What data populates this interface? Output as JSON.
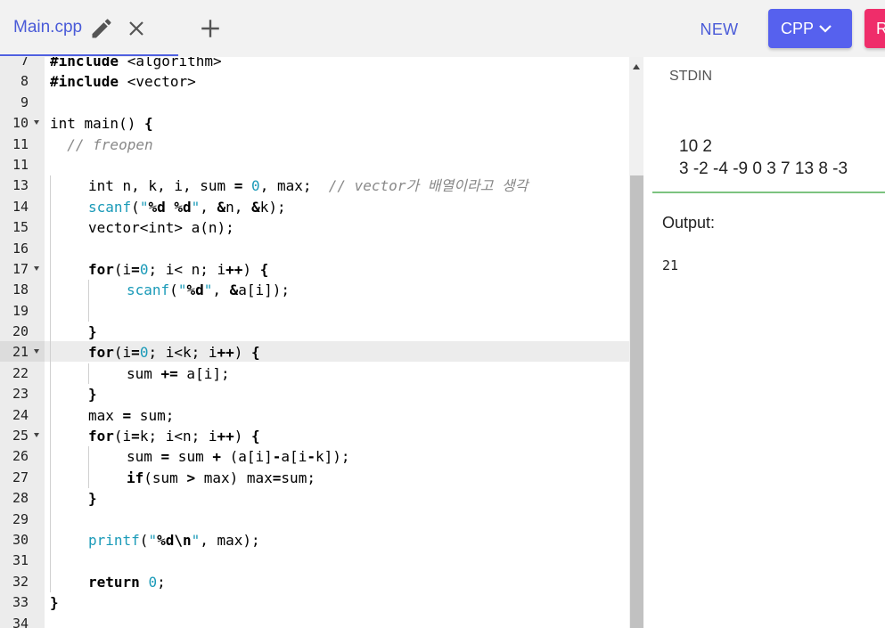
{
  "tab": {
    "filename": "Main.cpp"
  },
  "toolbar": {
    "new_label": "NEW",
    "language": "CPP",
    "run_label": "R"
  },
  "icons": {
    "edit": "pencil-icon",
    "close": "close-icon",
    "add": "plus-icon",
    "dropdown": "chevron-down-icon"
  },
  "colors": {
    "accent": "#5661ee",
    "run": "#ef2d6a",
    "divider": "#7cc37f"
  },
  "editor": {
    "active_line": 21,
    "lines": [
      {
        "n": 7,
        "fold": false,
        "indent": 0,
        "tokens": [
          [
            "#include ",
            "kw"
          ],
          [
            "<algorithm>",
            "txt"
          ]
        ]
      },
      {
        "n": 8,
        "fold": false,
        "indent": 0,
        "tokens": [
          [
            "#include ",
            "kw"
          ],
          [
            "<vector>",
            "txt"
          ]
        ]
      },
      {
        "n": 9,
        "fold": false,
        "indent": 0,
        "tokens": []
      },
      {
        "n": 10,
        "fold": true,
        "indent": 0,
        "tokens": [
          [
            "int main() ",
            "txt"
          ],
          [
            "{",
            "kw"
          ]
        ]
      },
      {
        "n": 11,
        "fold": false,
        "indent": 0,
        "tokens": [
          [
            "  // freopen",
            "cm"
          ]
        ]
      },
      {
        "n": 11,
        "fold": false,
        "indent": 0,
        "tokens": []
      },
      {
        "n": 13,
        "fold": false,
        "indent": 1,
        "tokens": [
          [
            "int n, k, i, sum ",
            "txt"
          ],
          [
            "=",
            "kw"
          ],
          [
            " ",
            "txt"
          ],
          [
            "0",
            "num"
          ],
          [
            ", max;  ",
            "txt"
          ],
          [
            "// vector가 배열이라고 생각",
            "cm"
          ]
        ]
      },
      {
        "n": 14,
        "fold": false,
        "indent": 1,
        "tokens": [
          [
            "scanf",
            "fn"
          ],
          [
            "(",
            "txt"
          ],
          [
            "\"",
            "str"
          ],
          [
            "%d %d",
            "fmt"
          ],
          [
            "\"",
            "str"
          ],
          [
            ", ",
            "txt"
          ],
          [
            "&",
            "kw"
          ],
          [
            "n, ",
            "txt"
          ],
          [
            "&",
            "kw"
          ],
          [
            "k);",
            "txt"
          ]
        ]
      },
      {
        "n": 15,
        "fold": false,
        "indent": 1,
        "tokens": [
          [
            "vector<int> a(n);",
            "txt"
          ]
        ]
      },
      {
        "n": 16,
        "fold": false,
        "indent": 1,
        "tokens": []
      },
      {
        "n": 17,
        "fold": true,
        "indent": 1,
        "tokens": [
          [
            "for",
            "kw"
          ],
          [
            "(i",
            "txt"
          ],
          [
            "=",
            "kw"
          ],
          [
            "0",
            "num"
          ],
          [
            "; i< n; i",
            "txt"
          ],
          [
            "++",
            "kw"
          ],
          [
            ") ",
            "txt"
          ],
          [
            "{",
            "kw"
          ]
        ]
      },
      {
        "n": 18,
        "fold": false,
        "indent": 2,
        "tokens": [
          [
            "scanf",
            "fn"
          ],
          [
            "(",
            "txt"
          ],
          [
            "\"",
            "str"
          ],
          [
            "%d",
            "fmt"
          ],
          [
            "\"",
            "str"
          ],
          [
            ", ",
            "txt"
          ],
          [
            "&",
            "kw"
          ],
          [
            "a[i]);",
            "txt"
          ]
        ]
      },
      {
        "n": 19,
        "fold": false,
        "indent": 2,
        "tokens": []
      },
      {
        "n": 20,
        "fold": false,
        "indent": 1,
        "tokens": [
          [
            "}",
            "kw"
          ]
        ]
      },
      {
        "n": 21,
        "fold": true,
        "indent": 1,
        "tokens": [
          [
            "for",
            "kw"
          ],
          [
            "(i",
            "txt"
          ],
          [
            "=",
            "kw"
          ],
          [
            "0",
            "num"
          ],
          [
            "; i<k; i",
            "txt"
          ],
          [
            "++",
            "kw"
          ],
          [
            ") ",
            "txt"
          ],
          [
            "{",
            "kw"
          ]
        ]
      },
      {
        "n": 22,
        "fold": false,
        "indent": 2,
        "tokens": [
          [
            "sum ",
            "txt"
          ],
          [
            "+=",
            "kw"
          ],
          [
            " a[i];",
            "txt"
          ]
        ]
      },
      {
        "n": 23,
        "fold": false,
        "indent": 1,
        "tokens": [
          [
            "}",
            "kw"
          ]
        ]
      },
      {
        "n": 24,
        "fold": false,
        "indent": 1,
        "tokens": [
          [
            "max ",
            "txt"
          ],
          [
            "=",
            "kw"
          ],
          [
            " sum;",
            "txt"
          ]
        ]
      },
      {
        "n": 25,
        "fold": true,
        "indent": 1,
        "tokens": [
          [
            "for",
            "kw"
          ],
          [
            "(i",
            "txt"
          ],
          [
            "=",
            "kw"
          ],
          [
            "k; i<n; i",
            "txt"
          ],
          [
            "++",
            "kw"
          ],
          [
            ") ",
            "txt"
          ],
          [
            "{",
            "kw"
          ]
        ]
      },
      {
        "n": 26,
        "fold": false,
        "indent": 2,
        "tokens": [
          [
            "sum ",
            "txt"
          ],
          [
            "=",
            "kw"
          ],
          [
            " sum ",
            "txt"
          ],
          [
            "+",
            "kw"
          ],
          [
            " (a[i]",
            "txt"
          ],
          [
            "-",
            "kw"
          ],
          [
            "a[i",
            "txt"
          ],
          [
            "-",
            "kw"
          ],
          [
            "k]);",
            "txt"
          ]
        ]
      },
      {
        "n": 27,
        "fold": false,
        "indent": 2,
        "tokens": [
          [
            "if",
            "kw"
          ],
          [
            "(sum ",
            "txt"
          ],
          [
            ">",
            "kw"
          ],
          [
            " max) max",
            "txt"
          ],
          [
            "=",
            "kw"
          ],
          [
            "sum;",
            "txt"
          ]
        ]
      },
      {
        "n": 28,
        "fold": false,
        "indent": 1,
        "tokens": [
          [
            "}",
            "kw"
          ]
        ]
      },
      {
        "n": 29,
        "fold": false,
        "indent": 1,
        "tokens": []
      },
      {
        "n": 30,
        "fold": false,
        "indent": 1,
        "tokens": [
          [
            "printf",
            "fn"
          ],
          [
            "(",
            "txt"
          ],
          [
            "\"",
            "str"
          ],
          [
            "%d\\n",
            "fmt"
          ],
          [
            "\"",
            "str"
          ],
          [
            ", max);",
            "txt"
          ]
        ]
      },
      {
        "n": 31,
        "fold": false,
        "indent": 1,
        "tokens": []
      },
      {
        "n": 32,
        "fold": false,
        "indent": 1,
        "tokens": [
          [
            "return",
            "kw"
          ],
          [
            " ",
            "txt"
          ],
          [
            "0",
            "num"
          ],
          [
            ";",
            "txt"
          ]
        ]
      },
      {
        "n": 33,
        "fold": false,
        "indent": 0,
        "tokens": [
          [
            "}",
            "kw"
          ]
        ]
      },
      {
        "n": 34,
        "fold": false,
        "indent": 0,
        "tokens": []
      }
    ]
  },
  "stdin": {
    "label": "STDIN",
    "value": "10 2\n3 -2 -4 -9 0 3 7 13 8 -3"
  },
  "output": {
    "label": "Output:",
    "value": "21"
  }
}
